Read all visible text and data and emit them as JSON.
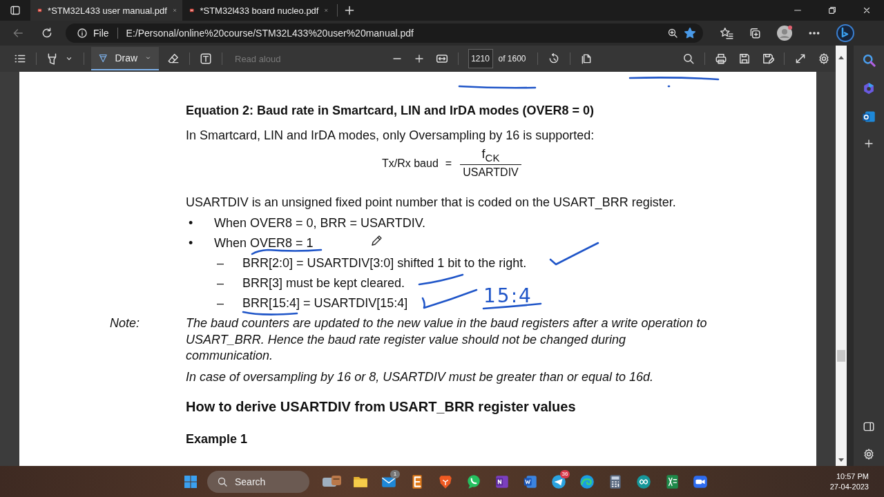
{
  "tabs": [
    {
      "title": "*STM32L433 user manual.pdf",
      "selected": true
    },
    {
      "title": "*STM32l433 board nucleo.pdf",
      "selected": false
    }
  ],
  "address_bar": {
    "back_disabled": true,
    "scheme": "File",
    "url": "E:/Personal/online%20course/STM32L433%20user%20manual.pdf",
    "favorite": true
  },
  "pdf_toolbar": {
    "draw_label": "Draw",
    "draw_selected": true,
    "read_aloud": "Read aloud",
    "read_aloud_disabled": true,
    "page": "1210",
    "page_count": "of 1600"
  },
  "document": {
    "blocks": [
      {
        "kind": "heading",
        "text": "Equation 2: Baud rate in Smartcard, LIN and IrDA modes (OVER8 = 0)"
      },
      {
        "kind": "paragraph",
        "text": "In Smartcard, LIN and IrDA modes, only Oversampling by 16 is supported:"
      },
      {
        "kind": "formula",
        "lhs": "Tx/Rx baud",
        "eq": "=",
        "numerator": "f$_{CK}$",
        "denominator": "USARTDIV"
      },
      {
        "kind": "paragraph",
        "text": "USARTDIV is an unsigned fixed point number that is coded on the USART_BRR register."
      },
      {
        "kind": "bullet",
        "marker": "•",
        "text": "When OVER8 = 0, BRR = USARTDIV."
      },
      {
        "kind": "bullet",
        "marker": "•",
        "text": "When OVER8 = 1"
      },
      {
        "kind": "dash",
        "marker": "–",
        "text": "BRR[2:0] = USARTDIV[3:0] shifted 1 bit to the right."
      },
      {
        "kind": "dash",
        "marker": "–",
        "text": "BRR[3] must be kept cleared."
      },
      {
        "kind": "dash",
        "marker": "–",
        "text": "BRR[15:4] = USARTDIV[15:4]"
      },
      {
        "kind": "note",
        "label": "Note:",
        "text": "The baud counters are updated to the new value in the baud registers after a write operation to USART_BRR. Hence the baud rate register value should not be changed during communication."
      },
      {
        "kind": "note_text",
        "text": "In case of oversampling by 16 or 8, USARTDIV must be greater than or equal to 16d."
      },
      {
        "kind": "section",
        "text": "How to derive USARTDIV from USART_BRR register values"
      },
      {
        "kind": "example",
        "text": "Example 1"
      }
    ],
    "handwritten_note": "15:4"
  },
  "taskbar": {
    "search": "Search",
    "apps": [
      {
        "kind": "explorer"
      },
      {
        "kind": "mail",
        "badge": "1"
      },
      {
        "kind": "e-app"
      },
      {
        "kind": "brave"
      },
      {
        "kind": "whatsapp"
      },
      {
        "kind": "onenote"
      },
      {
        "kind": "word"
      },
      {
        "kind": "telegram",
        "badge": "36"
      },
      {
        "kind": "edge"
      },
      {
        "kind": "calculator"
      },
      {
        "kind": "arduino"
      },
      {
        "kind": "sheet"
      },
      {
        "kind": "zoom"
      }
    ],
    "time": "10:57 PM",
    "date": "27-04-2023"
  }
}
